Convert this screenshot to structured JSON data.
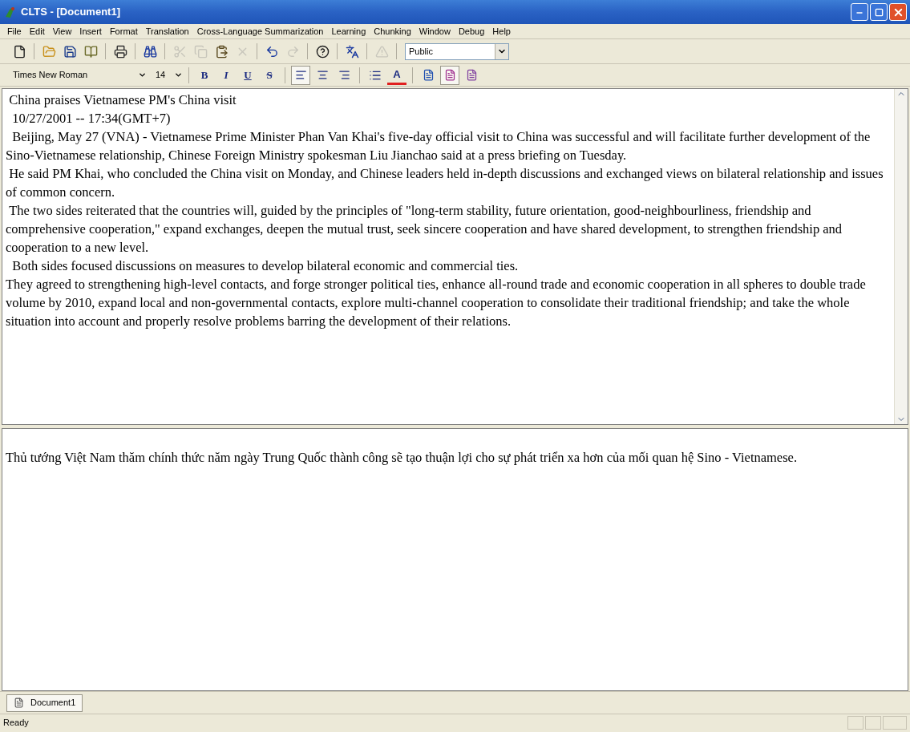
{
  "window": {
    "title": "CLTS - [Document1]"
  },
  "menu": [
    "File",
    "Edit",
    "View",
    "Insert",
    "Format",
    "Translation",
    "Cross-Language Summarization",
    "Learning",
    "Chunking",
    "Window",
    "Debug",
    "Help"
  ],
  "toolbar": [
    {
      "kind": "new",
      "disabled": false
    },
    {
      "kind": "sep"
    },
    {
      "kind": "open",
      "disabled": false
    },
    {
      "kind": "save",
      "disabled": false
    },
    {
      "kind": "book",
      "disabled": false
    },
    {
      "kind": "sep"
    },
    {
      "kind": "print",
      "disabled": false
    },
    {
      "kind": "sep"
    },
    {
      "kind": "find",
      "disabled": false
    },
    {
      "kind": "sep"
    },
    {
      "kind": "cut",
      "disabled": true
    },
    {
      "kind": "copy",
      "disabled": true
    },
    {
      "kind": "paste",
      "disabled": false
    },
    {
      "kind": "delete",
      "disabled": true
    },
    {
      "kind": "sep"
    },
    {
      "kind": "undo",
      "disabled": false
    },
    {
      "kind": "redo",
      "disabled": true
    },
    {
      "kind": "sep"
    },
    {
      "kind": "help",
      "disabled": false
    },
    {
      "kind": "sep"
    },
    {
      "kind": "translate",
      "disabled": false
    },
    {
      "kind": "sep"
    },
    {
      "kind": "warning",
      "disabled": true
    },
    {
      "kind": "sep"
    }
  ],
  "profile_select": {
    "value": "Public"
  },
  "format_bar": {
    "font": "Times New Roman",
    "size": "14",
    "styles": [
      {
        "label": "B",
        "kind": "bold"
      },
      {
        "label": "I",
        "kind": "italic"
      },
      {
        "label": "U",
        "kind": "underline"
      },
      {
        "label": "S",
        "kind": "strike"
      }
    ],
    "align": [
      {
        "kind": "left",
        "selected": true
      },
      {
        "kind": "center",
        "selected": false
      },
      {
        "kind": "right",
        "selected": false
      }
    ],
    "bullets": {
      "kind": "bullets"
    },
    "font_color": {
      "label": "A",
      "color": "#e02020"
    },
    "views": [
      {
        "kind": "blue",
        "selected": false
      },
      {
        "kind": "split",
        "selected": true
      },
      {
        "kind": "purple",
        "selected": false
      }
    ]
  },
  "source_text": [
    " China praises Vietnamese PM's China visit",
    "  10/27/2001 -- 17:34(GMT+7)",
    "  Beijing, May 27 (VNA) - Vietnamese Prime Minister Phan Van Khai's five-day official visit to China was successful and will facilitate further development of the Sino-Vietnamese relationship, Chinese Foreign Ministry spokesman Liu Jianchao said at a press briefing on Tuesday.",
    " He said PM Khai, who concluded the China visit on Monday, and Chinese leaders held in-depth discussions and exchanged views on bilateral relationship and issues of common concern.",
    " The two sides reiterated that the countries will, guided by the principles of \"long-term stability, future orientation, good-neighbourliness, friendship and comprehensive cooperation,\" expand exchanges, deepen the mutual trust, seek sincere cooperation and have shared development, to strengthen friendship and cooperation to a new level.",
    "  Both sides focused discussions on measures to develop bilateral economic and commercial ties.",
    "They agreed to strengthening high-level contacts, and forge stronger political ties, enhance all-round trade and economic cooperation in all spheres to double trade volume by 2010, expand local and non-governmental contacts, explore multi-channel cooperation to consolidate their traditional friendship; and take the whole situation into account and properly resolve problems barring the development of their relations."
  ],
  "summary_text": "Thủ tướng Việt Nam thăm chính thức năm ngày Trung Quốc thành công sẽ tạo thuận lợi cho sự phát triển xa hơn của mối quan hệ Sino - Vietnamese.",
  "document_tabs": [
    {
      "label": "Document1",
      "selected": true
    }
  ],
  "status_bar": {
    "text": "Ready"
  }
}
